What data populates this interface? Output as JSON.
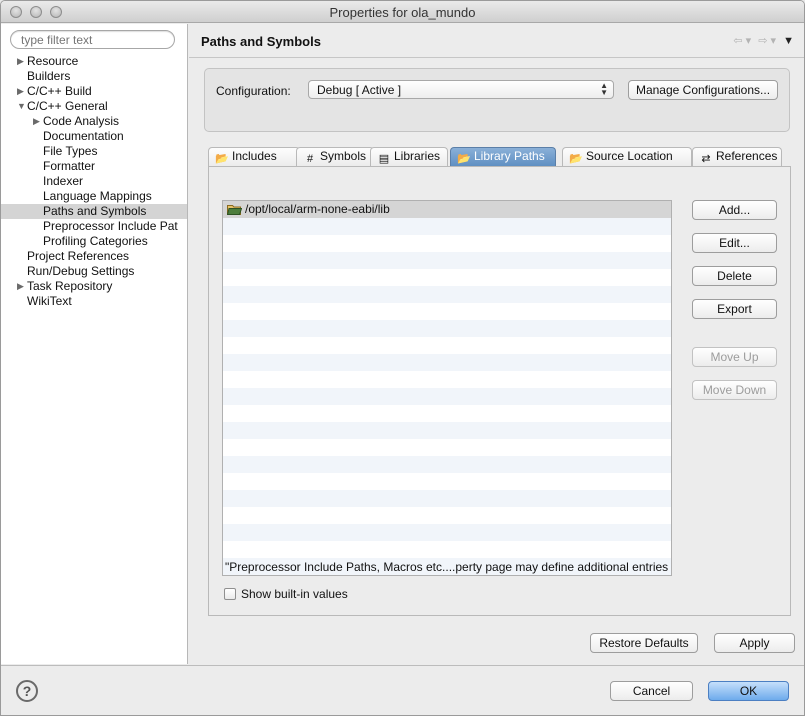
{
  "window": {
    "title": "Properties for ola_mundo"
  },
  "filter": {
    "placeholder": "type filter text"
  },
  "tree": [
    {
      "label": "Resource",
      "twisty": "▶",
      "level": 0,
      "selected": false
    },
    {
      "label": "Builders",
      "twisty": "",
      "level": 0,
      "selected": false
    },
    {
      "label": "C/C++ Build",
      "twisty": "▶",
      "level": 0,
      "selected": false
    },
    {
      "label": "C/C++ General",
      "twisty": "▼",
      "level": 0,
      "selected": false
    },
    {
      "label": "Code Analysis",
      "twisty": "▶",
      "level": 1,
      "selected": false
    },
    {
      "label": "Documentation",
      "twisty": "",
      "level": 1,
      "selected": false
    },
    {
      "label": "File Types",
      "twisty": "",
      "level": 1,
      "selected": false
    },
    {
      "label": "Formatter",
      "twisty": "",
      "level": 1,
      "selected": false
    },
    {
      "label": "Indexer",
      "twisty": "",
      "level": 1,
      "selected": false
    },
    {
      "label": "Language Mappings",
      "twisty": "",
      "level": 1,
      "selected": false
    },
    {
      "label": "Paths and Symbols",
      "twisty": "",
      "level": 1,
      "selected": true
    },
    {
      "label": "Preprocessor Include Pat",
      "twisty": "",
      "level": 1,
      "selected": false
    },
    {
      "label": "Profiling Categories",
      "twisty": "",
      "level": 1,
      "selected": false
    },
    {
      "label": "Project References",
      "twisty": "",
      "level": 0,
      "selected": false
    },
    {
      "label": "Run/Debug Settings",
      "twisty": "",
      "level": 0,
      "selected": false
    },
    {
      "label": "Task Repository",
      "twisty": "▶",
      "level": 0,
      "selected": false
    },
    {
      "label": "WikiText",
      "twisty": "",
      "level": 0,
      "selected": false
    }
  ],
  "header": {
    "title": "Paths and Symbols",
    "nav_back": "⇦ ▾",
    "nav_forward": "⇨ ▾",
    "nav_menu": "▼"
  },
  "config": {
    "label": "Configuration:",
    "selected": "Debug  [ Active ]",
    "manage_label": "Manage Configurations..."
  },
  "tabs": [
    {
      "label": "Includes",
      "icon": "includes-icon",
      "glyph": "📂",
      "active": false
    },
    {
      "label": "Symbols",
      "icon": "symbols-icon",
      "glyph": "#",
      "active": false
    },
    {
      "label": "Libraries",
      "icon": "libraries-icon",
      "glyph": "▤",
      "active": false
    },
    {
      "label": "Library Paths",
      "icon": "library-paths-icon",
      "glyph": "📂",
      "active": true
    },
    {
      "label": "Source Location",
      "icon": "source-location-icon",
      "glyph": "📂",
      "active": false
    },
    {
      "label": "References",
      "icon": "references-icon",
      "glyph": "⇄",
      "active": false
    }
  ],
  "list": {
    "rows": [
      "/opt/local/arm-none-eabi/lib"
    ]
  },
  "side_buttons": {
    "add": "Add...",
    "edit": "Edit...",
    "delete": "Delete",
    "export": "Export",
    "move_up": "Move Up",
    "move_down": "Move Down"
  },
  "note": "\"Preprocessor Include Paths, Macros etc....perty page may define additional entries",
  "show_builtin": {
    "label": "Show built-in values",
    "checked": false
  },
  "footer": {
    "restore_defaults": "Restore Defaults",
    "apply": "Apply",
    "cancel": "Cancel",
    "ok": "OK",
    "help": "?"
  },
  "colors": {
    "accent": "#5f8fc2",
    "selection": "#d4d4d4",
    "primary_button": "#6eabec"
  }
}
